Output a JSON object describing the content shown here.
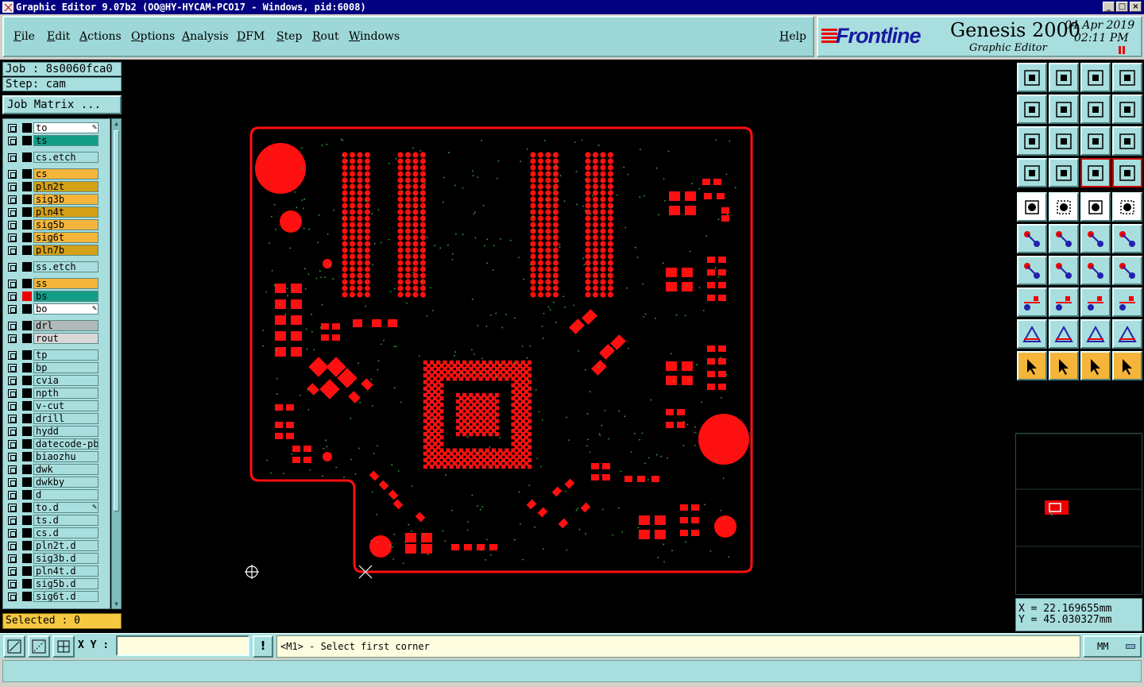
{
  "window": {
    "title": "Graphic Editor 9.07b2 (OO@HY-HYCAM-PCO17 - Windows, pid:6008)"
  },
  "menu": {
    "items": [
      "File",
      "Edit",
      "Actions",
      "Options",
      "Analysis",
      "DFM",
      "Step",
      "Rout",
      "Windows"
    ],
    "help": "Help"
  },
  "brand": {
    "logo": "Frontline",
    "product": "Genesis 2000",
    "subtitle": "Graphic Editor",
    "date": "04 Apr 2019",
    "time": "02:11 PM"
  },
  "job": {
    "label": "Job : 8s0060fca0",
    "step": "Step: cam",
    "matrix_button": "Job Matrix ..."
  },
  "layers": [
    {
      "name": "to",
      "color": "#ffffff",
      "edit": true
    },
    {
      "name": "ts",
      "color": "#129e86"
    },
    {
      "name": "cs.etch",
      "color": "#a8dede"
    },
    {
      "name": "cs",
      "color": "#f5b53a"
    },
    {
      "name": "pln2t",
      "color": "#d4a017"
    },
    {
      "name": "sig3b",
      "color": "#f5b53a"
    },
    {
      "name": "pln4t",
      "color": "#d4a017"
    },
    {
      "name": "sig5b",
      "color": "#f5b53a"
    },
    {
      "name": "sig6t",
      "color": "#f5b53a"
    },
    {
      "name": "pln7b",
      "color": "#d4a017"
    },
    {
      "name": "ss.etch",
      "color": "#a8dede"
    },
    {
      "name": "ss",
      "color": "#f5b53a"
    },
    {
      "name": "bs",
      "color": "#129e86",
      "active": true
    },
    {
      "name": "bo",
      "color": "#ffffff",
      "edit": true
    },
    {
      "name": "drl",
      "color": "#b0b8b8"
    },
    {
      "name": "rout",
      "color": "#d8d8d8"
    },
    {
      "name": "tp",
      "color": "#a8dede"
    },
    {
      "name": "bp",
      "color": "#a8dede"
    },
    {
      "name": "cvia",
      "color": "#a8dede"
    },
    {
      "name": "npth",
      "color": "#a8dede"
    },
    {
      "name": "v-cut",
      "color": "#a8dede"
    },
    {
      "name": "drill",
      "color": "#a8dede"
    },
    {
      "name": "hydd",
      "color": "#a8dede"
    },
    {
      "name": "datecode-pbo",
      "color": "#a8dede"
    },
    {
      "name": "biaozhu",
      "color": "#a8dede"
    },
    {
      "name": "dwk",
      "color": "#a8dede"
    },
    {
      "name": "dwkby",
      "color": "#a8dede"
    },
    {
      "name": "d",
      "color": "#a8dede"
    },
    {
      "name": "to.d",
      "color": "#a8dede",
      "edit": true
    },
    {
      "name": "ts.d",
      "color": "#a8dede"
    },
    {
      "name": "cs.d",
      "color": "#a8dede"
    },
    {
      "name": "pln2t.d",
      "color": "#a8dede"
    },
    {
      "name": "sig3b.d",
      "color": "#a8dede"
    },
    {
      "name": "pln4t.d",
      "color": "#a8dede"
    },
    {
      "name": "sig5b.d",
      "color": "#a8dede"
    },
    {
      "name": "sig6t.d",
      "color": "#a8dede"
    }
  ],
  "selected": "Selected : 0",
  "coords": {
    "x": "X = 22.169655mm",
    "y": "Y = 45.030327mm"
  },
  "bottom": {
    "xy_label": "X Y :",
    "xy_value": "",
    "status": "<M1> - Select first corner",
    "units": "MM"
  },
  "colors": {
    "accent": "#a8dede",
    "pcb": "#ff0000",
    "highlight": "#f5b53a"
  }
}
